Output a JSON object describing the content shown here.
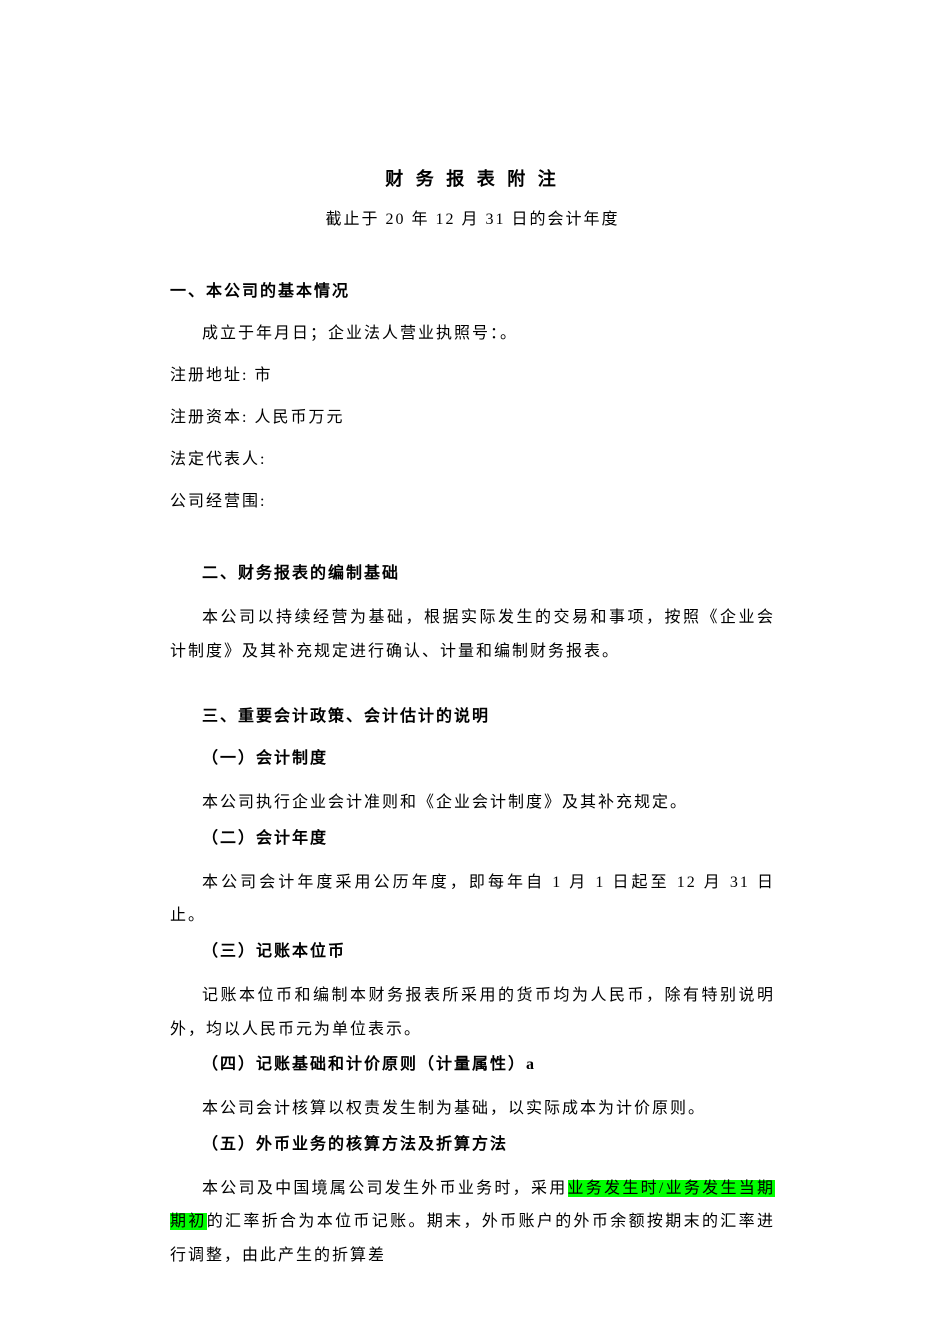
{
  "title": "财 务 报 表 附 注",
  "subtitle": "截止于 20 年 12 月 31 日的会计年度",
  "s1": {
    "heading": "一、本公司的基本情况",
    "line1": "成立于年月日；企业法人营业执照号：。",
    "addr": "注册地址: 市",
    "capital": "注册资本: 人民币万元",
    "rep": "法定代表人:",
    "scope": "公司经营围:"
  },
  "s2": {
    "heading": "二、财务报表的编制基础",
    "para": "本公司以持续经营为基础，根据实际发生的交易和事项，按照《企业会计制度》及其补充规定进行确认、计量和编制财务报表。"
  },
  "s3": {
    "heading": "三、重要会计政策、会计估计的说明",
    "r1h": "（一）会计制度",
    "r1p": "本公司执行企业会计准则和《企业会计制度》及其补充规定。",
    "r2h": "（二）会计年度",
    "r2p": "本公司会计年度采用公历年度，即每年自 1 月 1 日起至 12 月 31 日止。",
    "r3h": "（三）记账本位币",
    "r3p": "记账本位币和编制本财务报表所采用的货币均为人民币，除有特别说明外，均以人民币元为单位表示。",
    "r4h": "（四）记账基础和计价原则（计量属性）a",
    "r4p": "本公司会计核算以权责发生制为基础，以实际成本为计价原则。",
    "r5h": "（五）外币业务的核算方法及折算方法",
    "r5p_pre": "本公司及中国境属公司发生外币业务时，采用",
    "r5p_hl": "业务发生时/业务发生当期期初",
    "r5p_post": "的汇率折合为本位币记账。期末，外币账户的外币余额按期末的汇率进行调整，由此产生的折算差"
  }
}
